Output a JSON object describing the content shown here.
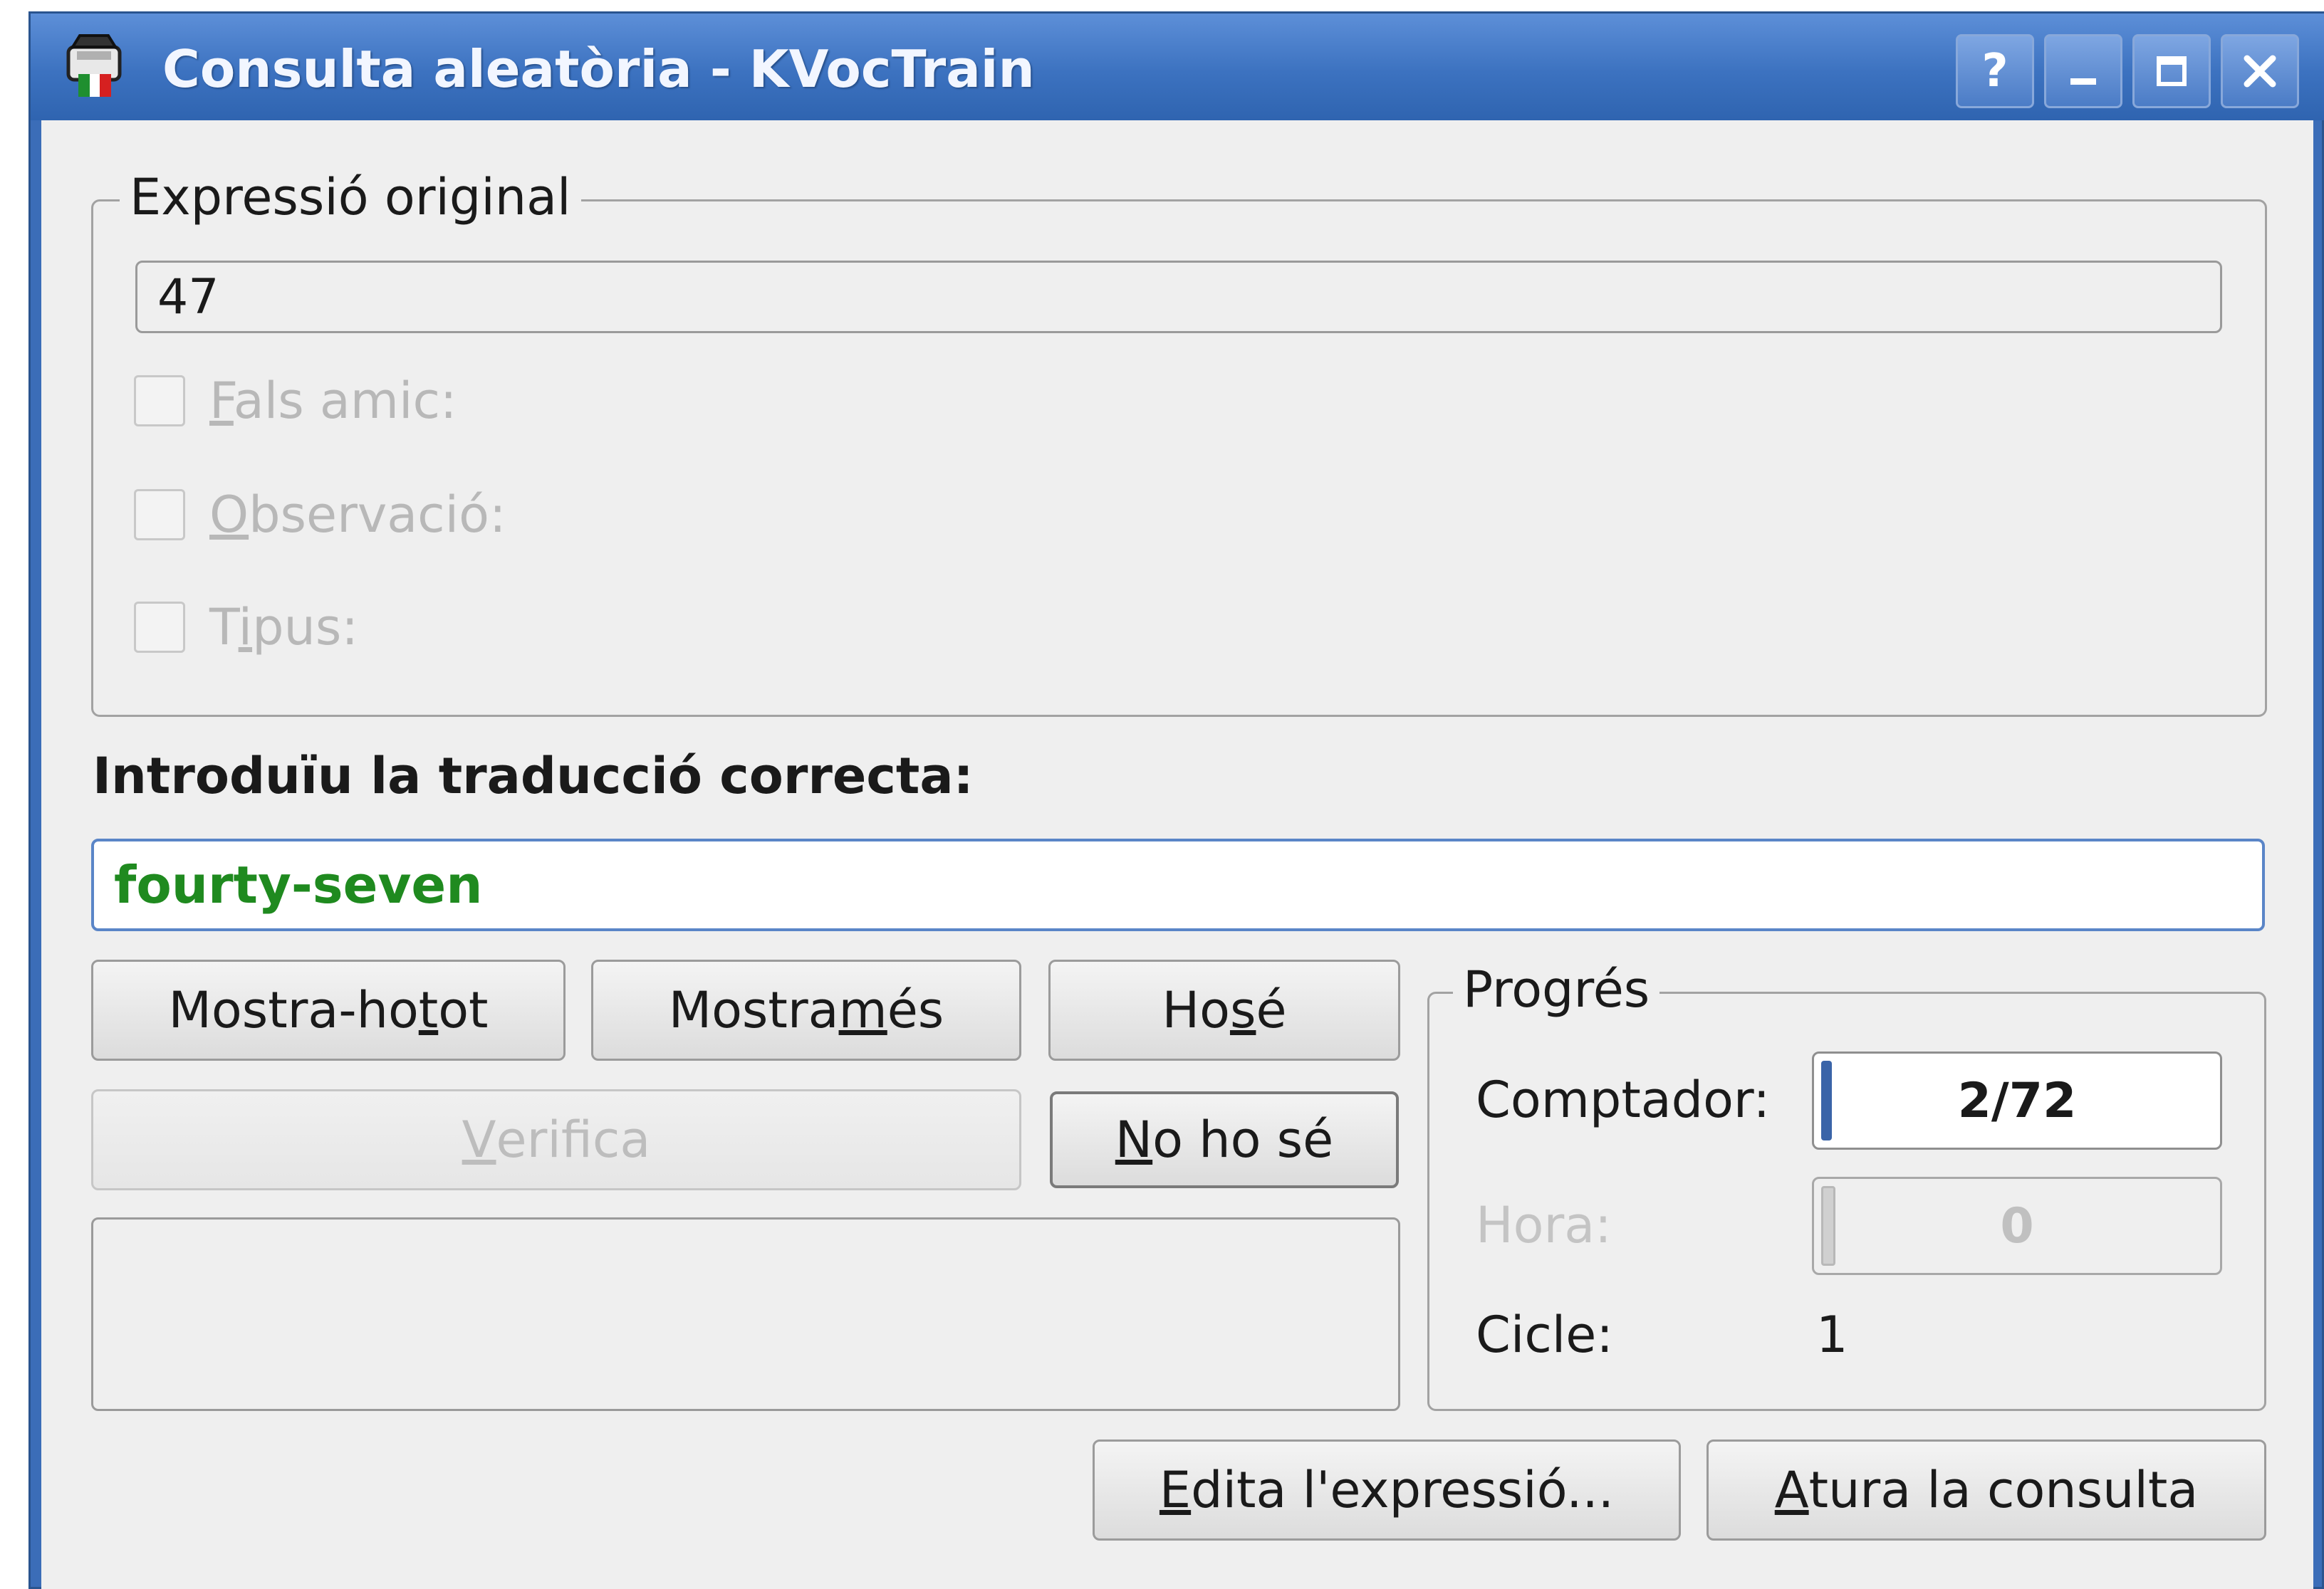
{
  "window": {
    "title": "Consulta aleatòria - KVocTrain",
    "controls": [
      "help-icon",
      "minimize-icon",
      "maximize-icon",
      "close-icon"
    ],
    "controls_text": {
      "help": "?"
    }
  },
  "original_group": {
    "legend": "Expressió original",
    "value": "47",
    "checkboxes": [
      {
        "label": "Fals amic:",
        "mnemonic": "F",
        "rest": "als amic:",
        "checked": false,
        "enabled": false
      },
      {
        "label": "Observació:",
        "mnemonic": "O",
        "rest": "bservació:",
        "checked": false,
        "enabled": false
      },
      {
        "label": "Tipus:",
        "pre": "T",
        "mnemonic": "i",
        "rest": "pus:",
        "checked": false,
        "enabled": false
      }
    ]
  },
  "answer": {
    "prompt": "Introduïu la traducció correcta:",
    "value": "fourty-seven",
    "value_color": "#1f8a1f"
  },
  "buttons": {
    "show_all": {
      "pre": "Mostra-ho ",
      "mn": "t",
      "post": "ot"
    },
    "show_more": {
      "pre": "Mostra ",
      "mn": "m",
      "post": "és"
    },
    "know": {
      "pre": "Ho ",
      "mn": "s",
      "post": "é"
    },
    "verify": {
      "pre": "",
      "mn": "V",
      "post": "erifica",
      "enabled": false
    },
    "dont_know": {
      "pre": "",
      "mn": "N",
      "post": "o ho sé"
    },
    "edit": {
      "pre": "",
      "mn": "E",
      "post": "dita l'expressió..."
    },
    "stop": {
      "pre": "",
      "mn": "A",
      "post": "tura la consulta"
    }
  },
  "progress": {
    "legend": "Progrés",
    "counter_label": "Comptador:",
    "counter_value": "2/72",
    "counter_fraction": 0.028,
    "time_label": "Hora:",
    "time_value": "0",
    "time_fraction": 0.0,
    "cycle_label": "Cicle:",
    "cycle_value": "1"
  },
  "colors": {
    "titlebar": "#3c72c0",
    "window_bg": "#efefef",
    "answer_text": "#1f8a1f",
    "meter_fill": "#3a64a8"
  }
}
